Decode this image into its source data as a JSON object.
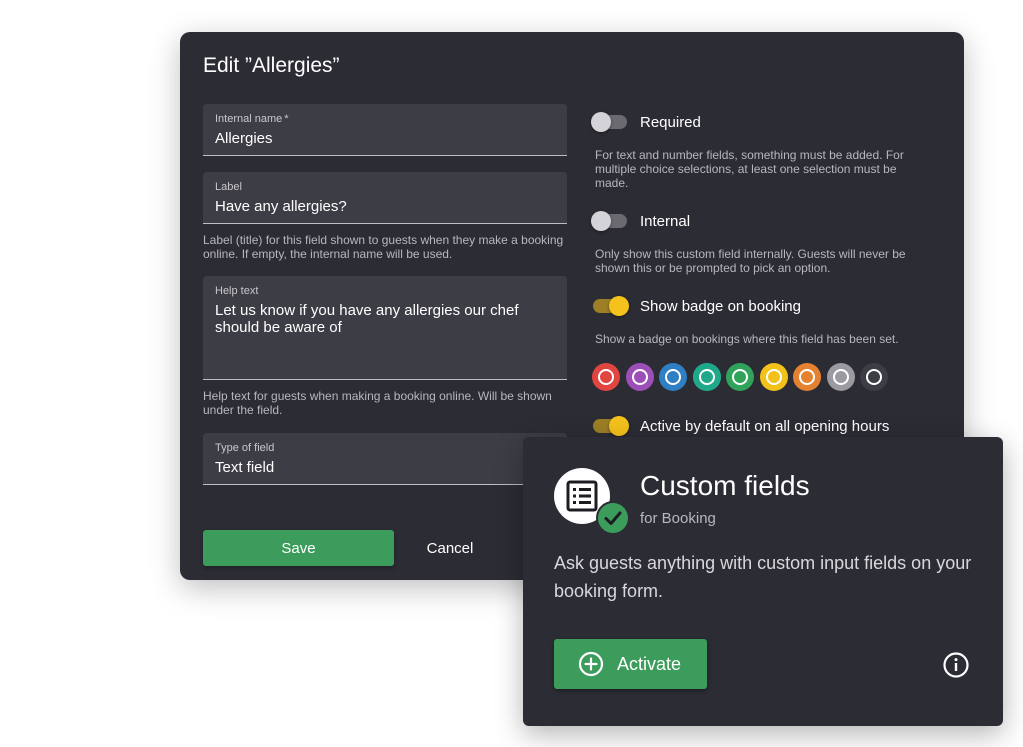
{
  "dialog": {
    "title": "Edit ”Allergies”",
    "fields": {
      "internal_name": {
        "label": "Internal name",
        "required_mark": "*",
        "value": "Allergies"
      },
      "label": {
        "label": "Label",
        "value": "Have any allergies?",
        "hint": "Label (title) for this field shown to guests when they make a booking online. If empty, the internal name will be used."
      },
      "help_text": {
        "label": "Help text",
        "value": "Let us know if you have any allergies our chef should be aware of",
        "hint": "Help text for guests when making a booking online. Will be shown under the field."
      },
      "type": {
        "label": "Type of field",
        "value": "Text field"
      }
    },
    "toggles": {
      "required": {
        "label": "Required",
        "on": false,
        "hint": "For text and number fields, something must be added. For multiple choice selections, at least one selection must be made."
      },
      "internal": {
        "label": "Internal",
        "on": false,
        "hint": "Only show this custom field internally. Guests will never be shown this or be prompted to pick an option."
      },
      "badge": {
        "label": "Show badge on booking",
        "on": true,
        "hint": "Show a badge on bookings where this field has been set."
      },
      "active_default": {
        "label": "Active by default on all opening hours",
        "on": true
      }
    },
    "badge_colors": [
      "#e0453f",
      "#9c4fb6",
      "#2e7fc4",
      "#1fa88a",
      "#2fa35a",
      "#f2c21b",
      "#e58231",
      "#9a9aa0",
      "#3d3d45"
    ],
    "selected_color": "#1fa88a",
    "save_label": "Save",
    "cancel_label": "Cancel"
  },
  "card": {
    "icon": "list-icon",
    "badge_icon": "checkmark-icon",
    "title": "Custom fields",
    "subtitle": "for Booking",
    "description": "Ask guests anything with custom input fields on your booking form.",
    "activate_label": "Activate",
    "activate_icon": "plus-circle-icon",
    "info_icon": "info-icon"
  },
  "colors": {
    "background": "#2c2c34",
    "field": "#3d3d45",
    "accent_green": "#3c9c5c",
    "toggle_yellow": "#f4c21b"
  }
}
